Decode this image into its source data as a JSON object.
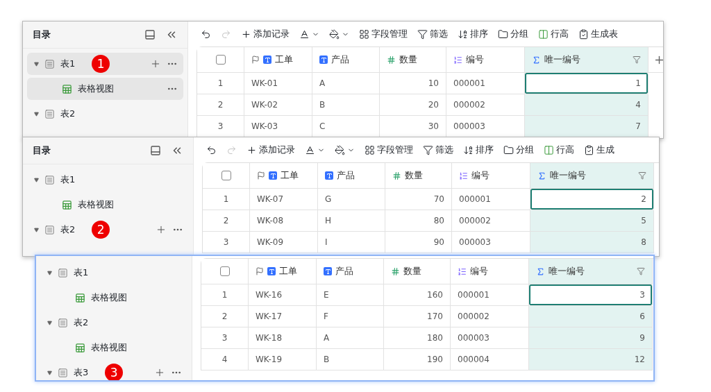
{
  "panels": [
    {
      "sidebar": {
        "title": "目录",
        "tree": [
          {
            "label": "表1",
            "expanded": true,
            "highlighted": true,
            "show_actions": true,
            "badge": "1",
            "children": [
              {
                "label": "表格视图",
                "selected": true
              }
            ]
          },
          {
            "label": "表2",
            "expanded": true,
            "highlighted": false,
            "show_actions": false
          }
        ]
      },
      "toolbar": [
        {
          "kind": "undo",
          "disabled": false
        },
        {
          "kind": "redo",
          "disabled": true
        },
        {
          "kind": "add",
          "label": "添加记录",
          "disabled": false
        },
        {
          "kind": "font-color",
          "disabled": false
        },
        {
          "kind": "fill-color",
          "disabled": false
        },
        {
          "kind": "fields",
          "label": "字段管理",
          "disabled": false
        },
        {
          "kind": "filter",
          "label": "筛选",
          "disabled": false
        },
        {
          "kind": "sort",
          "label": "排序",
          "disabled": false
        },
        {
          "kind": "group",
          "label": "分组",
          "disabled": false
        },
        {
          "kind": "row-height",
          "label": "行高",
          "disabled": false
        },
        {
          "kind": "form",
          "label": "生成表",
          "disabled": false
        }
      ],
      "table": {
        "add_column": true,
        "header_checked": false,
        "columns": [
          {
            "kind": "primary-text",
            "label": "工单"
          },
          {
            "kind": "text",
            "label": "产品"
          },
          {
            "kind": "number",
            "label": "数量"
          },
          {
            "kind": "autonumber",
            "label": "编号"
          },
          {
            "kind": "formula",
            "label": "唯一编号"
          }
        ],
        "rows": [
          {
            "index": "1",
            "cells": [
              "WK-01",
              "A",
              "10",
              "000001",
              "1"
            ],
            "focused": true
          },
          {
            "index": "2",
            "cells": [
              "WK-02",
              "B",
              "20",
              "000002",
              "4"
            ],
            "focused": false
          },
          {
            "index": "3",
            "cells": [
              "WK-03",
              "C",
              "30",
              "000003",
              "7"
            ],
            "focused": false
          }
        ]
      }
    },
    {
      "sidebar": {
        "title": "目录",
        "tree": [
          {
            "label": "表1",
            "expanded": true,
            "highlighted": false,
            "show_actions": false,
            "children": [
              {
                "label": "表格视图",
                "selected": false
              }
            ]
          },
          {
            "label": "表2",
            "expanded": true,
            "highlighted": false,
            "show_actions": true,
            "badge": "2"
          }
        ]
      },
      "toolbar": [
        {
          "kind": "undo",
          "disabled": false
        },
        {
          "kind": "redo",
          "disabled": true
        },
        {
          "kind": "add",
          "label": "添加记录",
          "disabled": false
        },
        {
          "kind": "font-color",
          "disabled": false
        },
        {
          "kind": "fill-color",
          "disabled": false
        },
        {
          "kind": "fields",
          "label": "字段管理",
          "disabled": false
        },
        {
          "kind": "filter",
          "label": "筛选",
          "disabled": false
        },
        {
          "kind": "sort",
          "label": "排序",
          "disabled": false
        },
        {
          "kind": "group",
          "label": "分组",
          "disabled": false
        },
        {
          "kind": "row-height",
          "label": "行高",
          "disabled": false
        },
        {
          "kind": "form",
          "label": "生成",
          "disabled": false
        }
      ],
      "table": {
        "header_checked": false,
        "columns": [
          {
            "kind": "primary-text",
            "label": "工单"
          },
          {
            "kind": "text",
            "label": "产品"
          },
          {
            "kind": "number",
            "label": "数量"
          },
          {
            "kind": "autonumber",
            "label": "编号"
          },
          {
            "kind": "formula",
            "label": "唯一编号"
          }
        ],
        "rows": [
          {
            "index": "1",
            "cells": [
              "WK-07",
              "G",
              "70",
              "000001",
              "2"
            ],
            "focused": true
          },
          {
            "index": "2",
            "cells": [
              "WK-08",
              "H",
              "80",
              "000002",
              "5"
            ],
            "focused": false
          },
          {
            "index": "3",
            "cells": [
              "WK-09",
              "I",
              "90",
              "000003",
              "8"
            ],
            "focused": false
          }
        ]
      }
    },
    {
      "sidebar": {
        "tree": [
          {
            "label": "表1",
            "expanded": true,
            "highlighted": false,
            "show_actions": false,
            "children": [
              {
                "label": "表格视图",
                "selected": false
              }
            ]
          },
          {
            "label": "表2",
            "expanded": true,
            "highlighted": false,
            "show_actions": false,
            "children": [
              {
                "label": "表格视图",
                "selected": false
              }
            ]
          },
          {
            "label": "表3",
            "expanded": true,
            "highlighted": false,
            "show_actions": true,
            "badge": "3"
          }
        ]
      },
      "table": {
        "header_checked": false,
        "columns": [
          {
            "kind": "primary-text",
            "label": "工单"
          },
          {
            "kind": "text",
            "label": "产品"
          },
          {
            "kind": "number",
            "label": "数量"
          },
          {
            "kind": "autonumber",
            "label": "编号"
          },
          {
            "kind": "formula",
            "label": "唯一编号"
          }
        ],
        "rows": [
          {
            "index": "1",
            "cells": [
              "WK-16",
              "E",
              "160",
              "000001",
              "3"
            ],
            "focused": true
          },
          {
            "index": "2",
            "cells": [
              "WK-17",
              "F",
              "170",
              "000002",
              "6"
            ],
            "focused": false
          },
          {
            "index": "3",
            "cells": [
              "WK-18",
              "A",
              "180",
              "000003",
              "9"
            ],
            "focused": false
          },
          {
            "index": "4",
            "cells": [
              "WK-19",
              "B",
              "190",
              "000004",
              "12"
            ],
            "focused": false
          }
        ]
      }
    }
  ]
}
